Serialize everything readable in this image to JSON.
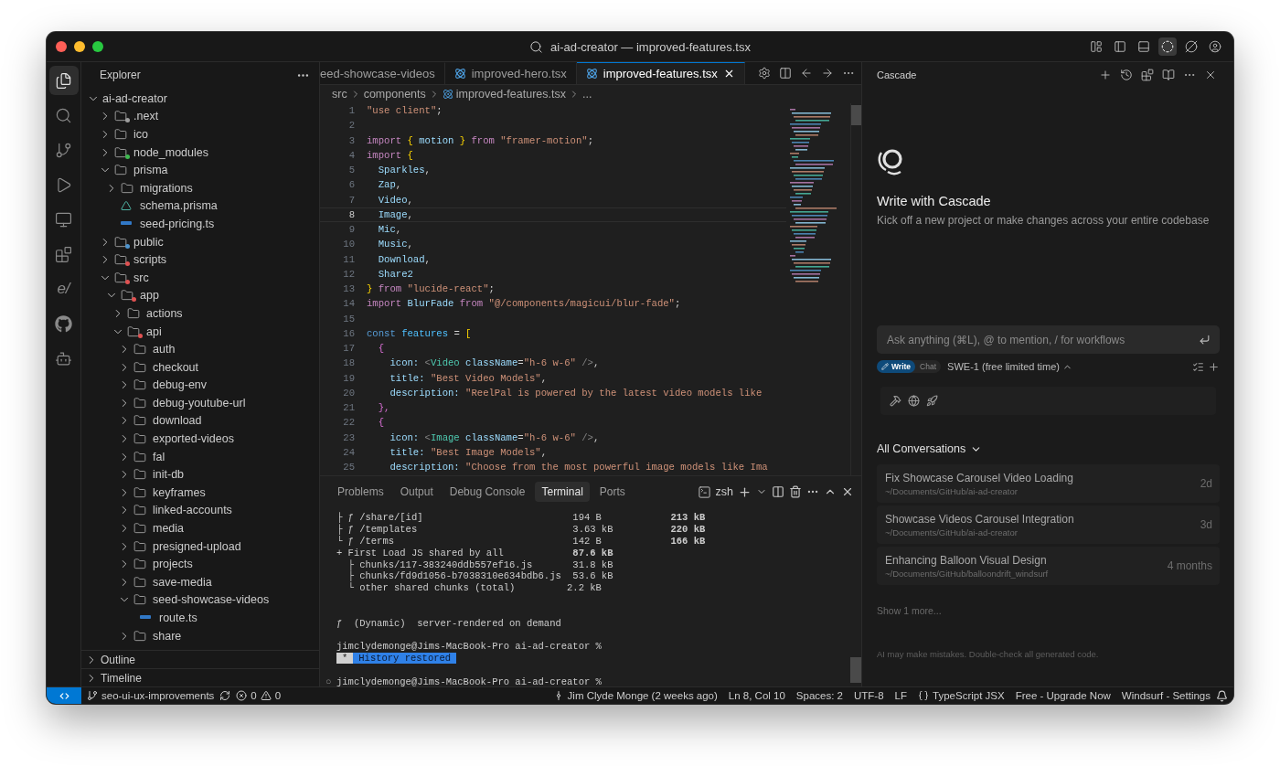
{
  "window": {
    "title": "ai-ad-creator — improved-features.tsx"
  },
  "title_actions": [
    {
      "kind": "layout",
      "selected": false
    },
    {
      "kind": "sidebar",
      "selected": false
    },
    {
      "kind": "panel",
      "selected": false
    },
    {
      "kind": "cascade",
      "selected": true
    },
    {
      "kind": "slashed",
      "selected": false
    },
    {
      "kind": "account",
      "selected": false
    }
  ],
  "activity_bar": [
    {
      "kind": "files",
      "selected": true
    },
    {
      "kind": "search",
      "selected": false
    },
    {
      "kind": "source-control",
      "selected": false
    },
    {
      "kind": "run",
      "selected": false
    },
    {
      "kind": "remote",
      "selected": false
    },
    {
      "kind": "extensions",
      "selected": false
    },
    {
      "kind": "text",
      "label": "e/",
      "selected": false
    },
    {
      "kind": "github",
      "selected": false
    },
    {
      "kind": "bot",
      "selected": false
    }
  ],
  "sidebar": {
    "title": "Explorer",
    "tree": [
      {
        "name": "ai-ad-creator",
        "kind": "root",
        "expanded": true,
        "children": [
          {
            "name": ".next",
            "kind": "folder",
            "expanded": false,
            "color": "#9e9e9e"
          },
          {
            "name": "ico",
            "kind": "folder",
            "expanded": false
          },
          {
            "name": "node_modules",
            "kind": "folder",
            "expanded": false,
            "color": "#3fb950"
          },
          {
            "name": "prisma",
            "kind": "folder",
            "expanded": true,
            "children": [
              {
                "name": "migrations",
                "kind": "folder",
                "expanded": false
              },
              {
                "name": "schema.prisma",
                "kind": "prisma"
              },
              {
                "name": "seed-pricing.ts",
                "kind": "ts"
              }
            ]
          },
          {
            "name": "public",
            "kind": "folder",
            "expanded": false,
            "color": "#4e94ce"
          },
          {
            "name": "scripts",
            "kind": "folder",
            "expanded": false,
            "color": "#e05252"
          },
          {
            "name": "src",
            "kind": "folder",
            "expanded": true,
            "color": "#e05252",
            "children": [
              {
                "name": "app",
                "kind": "folder",
                "expanded": true,
                "color": "#e05252",
                "children": [
                  {
                    "name": "actions",
                    "kind": "folder",
                    "expanded": false
                  },
                  {
                    "name": "api",
                    "kind": "folder",
                    "expanded": true,
                    "color": "#e05252",
                    "children": [
                      {
                        "name": "auth",
                        "kind": "folder",
                        "expanded": false
                      },
                      {
                        "name": "checkout",
                        "kind": "folder",
                        "expanded": false
                      },
                      {
                        "name": "debug-env",
                        "kind": "folder",
                        "expanded": false
                      },
                      {
                        "name": "debug-youtube-url",
                        "kind": "folder",
                        "expanded": false
                      },
                      {
                        "name": "download",
                        "kind": "folder",
                        "expanded": false
                      },
                      {
                        "name": "exported-videos",
                        "kind": "folder",
                        "expanded": false
                      },
                      {
                        "name": "fal",
                        "kind": "folder",
                        "expanded": false
                      },
                      {
                        "name": "init-db",
                        "kind": "folder",
                        "expanded": false
                      },
                      {
                        "name": "keyframes",
                        "kind": "folder",
                        "expanded": false
                      },
                      {
                        "name": "linked-accounts",
                        "kind": "folder",
                        "expanded": false
                      },
                      {
                        "name": "media",
                        "kind": "folder",
                        "expanded": false
                      },
                      {
                        "name": "presigned-upload",
                        "kind": "folder",
                        "expanded": false
                      },
                      {
                        "name": "projects",
                        "kind": "folder",
                        "expanded": false
                      },
                      {
                        "name": "save-media",
                        "kind": "folder",
                        "expanded": false
                      },
                      {
                        "name": "seed-showcase-videos",
                        "kind": "folder",
                        "expanded": true,
                        "children": [
                          {
                            "name": "route.ts",
                            "kind": "ts"
                          }
                        ]
                      },
                      {
                        "name": "share",
                        "kind": "folder",
                        "expanded": false
                      }
                    ]
                  }
                ]
              }
            ]
          }
        ]
      }
    ],
    "sections": [
      {
        "label": "Outline",
        "expanded": false
      },
      {
        "label": "Timeline",
        "expanded": false
      }
    ]
  },
  "editor": {
    "tabs": [
      {
        "label": "eed-showcase-videos",
        "kind": "plain",
        "selected": false
      },
      {
        "label": "improved-hero.tsx",
        "kind": "react",
        "selected": false
      },
      {
        "label": "improved-features.tsx",
        "kind": "react",
        "selected": true
      }
    ],
    "breadcrumb": [
      {
        "label": "src",
        "kind": "plain"
      },
      {
        "label": "components",
        "kind": "plain"
      },
      {
        "label": "improved-features.tsx",
        "kind": "react"
      },
      {
        "label": "...",
        "kind": "plain"
      }
    ],
    "lines": [
      {
        "number": "1",
        "current": false,
        "tokens": [
          {
            "text": "\"use client\"",
            "kind": "str"
          },
          {
            "text": ";",
            "kind": "punct"
          }
        ]
      },
      {
        "number": "2",
        "current": false
      },
      {
        "number": "3",
        "current": false,
        "tokens": [
          {
            "text": "import ",
            "kind": "kw"
          },
          {
            "text": "{ ",
            "kind": "brace"
          },
          {
            "text": "motion ",
            "kind": "var"
          },
          {
            "text": "} ",
            "kind": "brace"
          },
          {
            "text": "from ",
            "kind": "kw"
          },
          {
            "text": "\"framer-motion\"",
            "kind": "str"
          },
          {
            "text": ";",
            "kind": "punct"
          }
        ]
      },
      {
        "number": "4",
        "current": false,
        "tokens": [
          {
            "text": "import ",
            "kind": "kw"
          },
          {
            "text": "{",
            "kind": "brace"
          }
        ]
      },
      {
        "number": "5",
        "current": false,
        "tokens": [
          {
            "text": "  Sparkles",
            "kind": "var"
          },
          {
            "text": ",",
            "kind": "punct"
          }
        ]
      },
      {
        "number": "6",
        "current": false,
        "tokens": [
          {
            "text": "  Zap",
            "kind": "var"
          },
          {
            "text": ",",
            "kind": "punct"
          }
        ]
      },
      {
        "number": "7",
        "current": false,
        "tokens": [
          {
            "text": "  Video",
            "kind": "var"
          },
          {
            "text": ",",
            "kind": "punct"
          }
        ]
      },
      {
        "number": "8",
        "current": true,
        "tokens": [
          {
            "text": "  Image",
            "kind": "var"
          },
          {
            "text": ",",
            "kind": "punct"
          }
        ]
      },
      {
        "number": "9",
        "current": false,
        "tokens": [
          {
            "text": "  Mic",
            "kind": "var"
          },
          {
            "text": ",",
            "kind": "punct"
          }
        ]
      },
      {
        "number": "10",
        "current": false,
        "tokens": [
          {
            "text": "  Music",
            "kind": "var"
          },
          {
            "text": ",",
            "kind": "punct"
          }
        ]
      },
      {
        "number": "11",
        "current": false,
        "tokens": [
          {
            "text": "  Download",
            "kind": "var"
          },
          {
            "text": ",",
            "kind": "punct"
          }
        ]
      },
      {
        "number": "12",
        "current": false,
        "tokens": [
          {
            "text": "  Share2",
            "kind": "var"
          }
        ]
      },
      {
        "number": "13",
        "current": false,
        "tokens": [
          {
            "text": "} ",
            "kind": "brace"
          },
          {
            "text": "from ",
            "kind": "kw"
          },
          {
            "text": "\"lucide-react\"",
            "kind": "str"
          },
          {
            "text": ";",
            "kind": "punct"
          }
        ]
      },
      {
        "number": "14",
        "current": false,
        "tokens": [
          {
            "text": "import ",
            "kind": "kw"
          },
          {
            "text": "BlurFade ",
            "kind": "var"
          },
          {
            "text": "from ",
            "kind": "kw"
          },
          {
            "text": "\"@/components/magicui/blur-fade\"",
            "kind": "str"
          },
          {
            "text": ";",
            "kind": "punct"
          }
        ]
      },
      {
        "number": "15",
        "current": false
      },
      {
        "number": "16",
        "current": false,
        "tokens": [
          {
            "text": "const ",
            "kind": "storage"
          },
          {
            "text": "features ",
            "kind": "constvar"
          },
          {
            "text": "= ",
            "kind": "punct"
          },
          {
            "text": "[",
            "kind": "brace"
          }
        ]
      },
      {
        "number": "17",
        "current": false,
        "tokens": [
          {
            "text": "  {",
            "kind": "brace2"
          }
        ]
      },
      {
        "number": "18",
        "current": false,
        "tokens": [
          {
            "text": "    icon: ",
            "kind": "var"
          },
          {
            "text": "<",
            "kind": "tagpunct"
          },
          {
            "text": "Video ",
            "kind": "tag"
          },
          {
            "text": "className",
            "kind": "var"
          },
          {
            "text": "=",
            "kind": "punct"
          },
          {
            "text": "\"h-6 w-6\" ",
            "kind": "str"
          },
          {
            "text": "/>",
            "kind": "tagpunct"
          },
          {
            "text": ",",
            "kind": "punct"
          }
        ]
      },
      {
        "number": "19",
        "current": false,
        "tokens": [
          {
            "text": "    title: ",
            "kind": "var"
          },
          {
            "text": "\"Best Video Models\"",
            "kind": "str"
          },
          {
            "text": ",",
            "kind": "punct"
          }
        ]
      },
      {
        "number": "20",
        "current": false,
        "tokens": [
          {
            "text": "    description: ",
            "kind": "var"
          },
          {
            "text": "\"ReelPal is powered by the latest video models like",
            "kind": "str"
          }
        ]
      },
      {
        "number": "21",
        "current": false,
        "tokens": [
          {
            "text": "  },",
            "kind": "brace2"
          }
        ]
      },
      {
        "number": "22",
        "current": false,
        "tokens": [
          {
            "text": "  {",
            "kind": "brace2"
          }
        ]
      },
      {
        "number": "23",
        "current": false,
        "tokens": [
          {
            "text": "    icon: ",
            "kind": "var"
          },
          {
            "text": "<",
            "kind": "tagpunct"
          },
          {
            "text": "Image ",
            "kind": "tag"
          },
          {
            "text": "className",
            "kind": "var"
          },
          {
            "text": "=",
            "kind": "punct"
          },
          {
            "text": "\"h-6 w-6\" ",
            "kind": "str"
          },
          {
            "text": "/>",
            "kind": "tagpunct"
          },
          {
            "text": ",",
            "kind": "punct"
          }
        ]
      },
      {
        "number": "24",
        "current": false,
        "tokens": [
          {
            "text": "    title: ",
            "kind": "var"
          },
          {
            "text": "\"Best Image Models\"",
            "kind": "str"
          },
          {
            "text": ",",
            "kind": "punct"
          }
        ]
      },
      {
        "number": "25",
        "current": false,
        "tokens": [
          {
            "text": "    description: ",
            "kind": "var"
          },
          {
            "text": "\"Choose from the most powerful image models like Ima",
            "kind": "str"
          }
        ]
      }
    ]
  },
  "panel": {
    "tabs": [
      {
        "label": "Problems",
        "selected": false
      },
      {
        "label": "Output",
        "selected": false
      },
      {
        "label": "Debug Console",
        "selected": false
      },
      {
        "label": "Terminal",
        "selected": true
      },
      {
        "label": "Ports",
        "selected": false
      }
    ],
    "shell": "zsh",
    "terminal": [
      {
        "kind": "output",
        "text": "├ ƒ /share/[id]                          194 B            **213 kB**"
      },
      {
        "kind": "output",
        "text": "├ ƒ /templates                           3.63 kB          **220 kB**"
      },
      {
        "kind": "output",
        "text": "└ ƒ /terms                               142 B            **166 kB**"
      },
      {
        "kind": "output",
        "text": "+ First Load JS shared by all            **87.6 kB**"
      },
      {
        "kind": "output",
        "text": "  ├ chunks/117-383240ddb557ef16.js       31.8 kB"
      },
      {
        "kind": "output",
        "text": "  ├ chunks/fd9d1056-b7038310e634bdb6.js  53.6 kB"
      },
      {
        "kind": "output",
        "text": "  └ other shared chunks (total)         2.2 kB"
      },
      {
        "kind": "blank"
      },
      {
        "kind": "blank"
      },
      {
        "kind": "output",
        "text": "ƒ  (Dynamic)  server-rendered on demand"
      },
      {
        "kind": "blank"
      },
      {
        "kind": "prompt",
        "text": "jimclydemonge@Jims-MacBook-Pro ai-ad-creator %"
      },
      {
        "kind": "notice",
        "mark": "*",
        "text": "History restored"
      },
      {
        "kind": "blank"
      },
      {
        "kind": "prompt",
        "marker": "○",
        "text": "jimclydemonge@Jims-MacBook-Pro ai-ad-creator %"
      }
    ]
  },
  "cascade": {
    "title": "Cascade",
    "heading": "Write with Cascade",
    "subtitle": "Kick off a new project or make changes across your entire codebase",
    "input": {
      "placeholder": "Ask anything (⌘L), @ to mention, / for workflows"
    },
    "modes": [
      {
        "label": "Write",
        "selected": true
      },
      {
        "label": "Chat",
        "selected": false
      }
    ],
    "model": "SWE-1 (free limited time)",
    "conversations_title": "All Conversations",
    "conversations": [
      {
        "title": "Fix Showcase Carousel Video Loading",
        "path": "~/Documents/GitHub/ai-ad-creator",
        "age": "2d"
      },
      {
        "title": "Showcase Videos Carousel Integration",
        "path": "~/Documents/GitHub/ai-ad-creator",
        "age": "3d"
      },
      {
        "title": "Enhancing Balloon Visual Design",
        "path": "~/Documents/GitHub/balloondrift_windsurf",
        "age": "4 months"
      }
    ],
    "show_more": "Show 1 more...",
    "disclaimer": "AI may make mistakes. Double-check all generated code."
  },
  "status_bar": {
    "branch": "seo-ui-ux-improvements",
    "errors": "0",
    "warnings": "0",
    "items": [
      {
        "kind": "blame",
        "label": "Jim Clyde Monge (2 weeks ago)"
      },
      {
        "kind": "plain",
        "label": "Ln 8, Col 10"
      },
      {
        "kind": "plain",
        "label": "Spaces: 2"
      },
      {
        "kind": "plain",
        "label": "UTF-8"
      },
      {
        "kind": "plain",
        "label": "LF"
      },
      {
        "kind": "language",
        "label": "TypeScript JSX"
      },
      {
        "kind": "plain",
        "label": "Free - Upgrade Now"
      },
      {
        "kind": "plain",
        "label": "Windsurf - Settings"
      }
    ]
  }
}
